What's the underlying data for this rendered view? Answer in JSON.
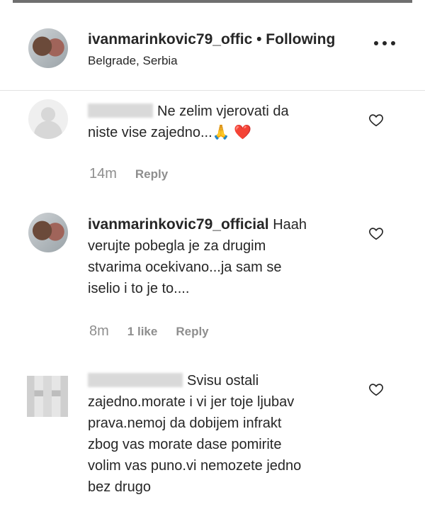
{
  "post": {
    "author": "ivanmarinkovic79_offic",
    "follow_status": "• Following",
    "location": "Belgrade, Serbia"
  },
  "comments": [
    {
      "author": "",
      "text_lines": [
        "Ne zelim vjerovati da",
        "niste vise zajedno...🙏 ❤️"
      ],
      "time": "14m",
      "likes": "",
      "reply_label": "Reply"
    },
    {
      "author": "ivanmarinkovic79_official",
      "text_lines": [
        "Haah",
        "verujte pobegla je za drugim",
        "stvarima ocekivano...ja sam se",
        "iselio i to je to...."
      ],
      "time": "8m",
      "likes": "1 like",
      "reply_label": "Reply"
    },
    {
      "author": "",
      "text_lines": [
        "Svisu ostali",
        "zajedno.morate i vi jer toje ljubav",
        "prava.nemoj da dobijem infrakt",
        "zbog vas morate dase pomirite",
        "volim vas puno.vi nemozete jedno",
        "bez drugo"
      ],
      "time": "",
      "likes": "",
      "reply_label": ""
    }
  ],
  "icons": {
    "more": "more-options-icon",
    "like": "heart-icon"
  }
}
